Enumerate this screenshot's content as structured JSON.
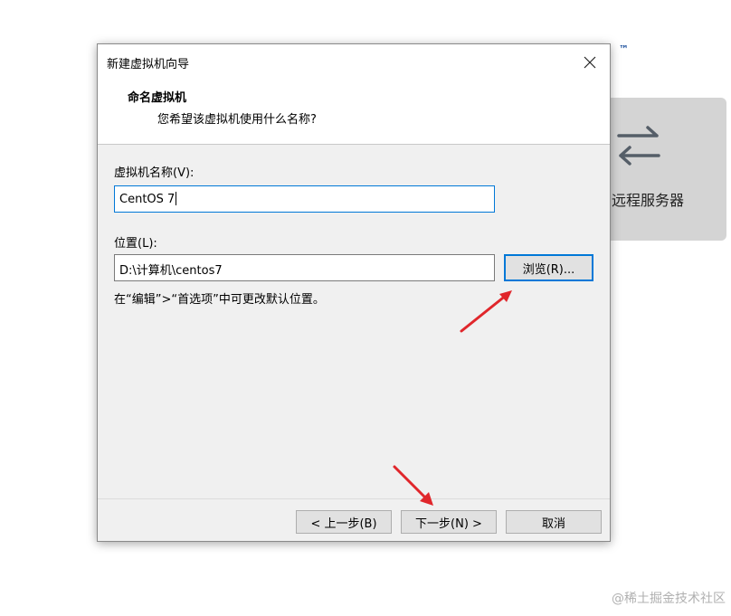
{
  "background": {
    "card_label": "远程服务器",
    "logo_tm": "™",
    "watermark": "@稀土掘金技术社区"
  },
  "dialog": {
    "title": "新建虚拟机向导",
    "header_title": "命名虚拟机",
    "header_subtitle": "您希望该虚拟机使用什么名称?",
    "vm_name_label": "虚拟机名称(V):",
    "vm_name_value": "CentOS 7",
    "location_label": "位置(L):",
    "location_value": "D:\\计算机\\centos7",
    "browse_label": "浏览(R)...",
    "hint": "在“编辑”>“首选项”中可更改默认位置。",
    "back_label": "< 上一步(B)",
    "next_label": "下一步(N) >",
    "cancel_label": "取消"
  },
  "colors": {
    "accent": "#0078d7",
    "annotation_arrow": "#e0262b"
  }
}
